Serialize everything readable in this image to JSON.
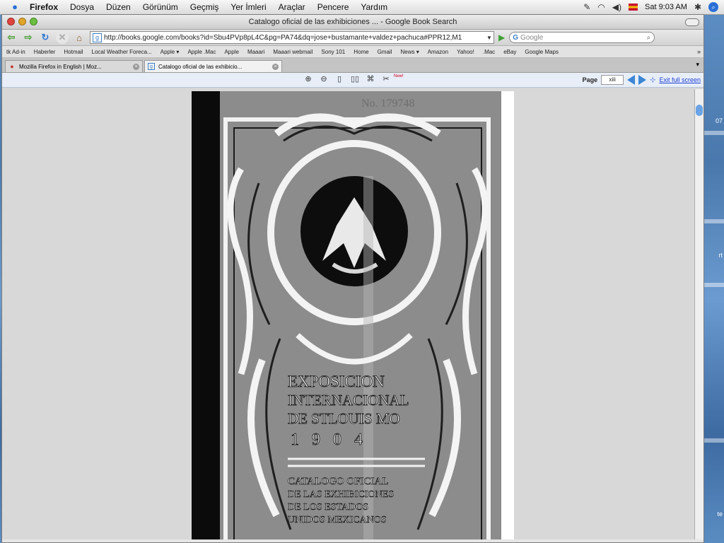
{
  "menubar": {
    "app_name": "Firefox",
    "items": [
      "Dosya",
      "Düzen",
      "Görünüm",
      "Geçmiş",
      "Yer İmleri",
      "Araçlar",
      "Pencere",
      "Yardım"
    ],
    "clock": "Sat 9:03 AM"
  },
  "window": {
    "title": "Catalogo oficial de las exhibiciones ... - Google Book Search"
  },
  "navbar": {
    "url": "http://books.google.com/books?id=Sbu4PVp8pL4C&pg=PA74&dq=jose+bustamante+valdez+pachuca#PPR12,M1",
    "search_engine": "G",
    "search_placeholder": "Google"
  },
  "bookmarks": [
    "tk Ad-in",
    "Haberler",
    "Hotmail",
    "Local Weather Foreca...",
    "Apple ▾",
    "Apple .Mac",
    "Apple",
    "Maaari",
    "Maaari webmail",
    "Sony 101",
    "Home",
    "Gmail",
    "News ▾",
    "Amazon",
    "Yahoo!",
    ".Mac",
    "eBay",
    "Google Maps"
  ],
  "tabs": [
    {
      "label": "Mozilla Firefox in English | Moz...",
      "active": false
    },
    {
      "label": "Catalogo oficial de las exhibicio...",
      "active": true
    }
  ],
  "book_toolbar": {
    "new_badge": "New!",
    "page_label": "Page",
    "page_value": "xiii",
    "exit_label": "Exit full screen"
  },
  "book": {
    "top_text": "No. 179748",
    "title_lines": [
      "EXPOSICION",
      "INTERNACIONAL",
      "DE STLOUIS MO",
      "1 9 0 4"
    ],
    "subtitle_lines": [
      "CATALOGO OFICIAL",
      "DE LAS EXHIBICIONES",
      "DE LOS ESTADOS",
      "UNIDOS MEXICANOS"
    ]
  },
  "desktop": {
    "side_labels": [
      "07",
      "rt",
      "te"
    ]
  },
  "colors": {
    "accent": "#3c86d4",
    "link": "#1a3ed6",
    "go_green": "#4ca035"
  }
}
